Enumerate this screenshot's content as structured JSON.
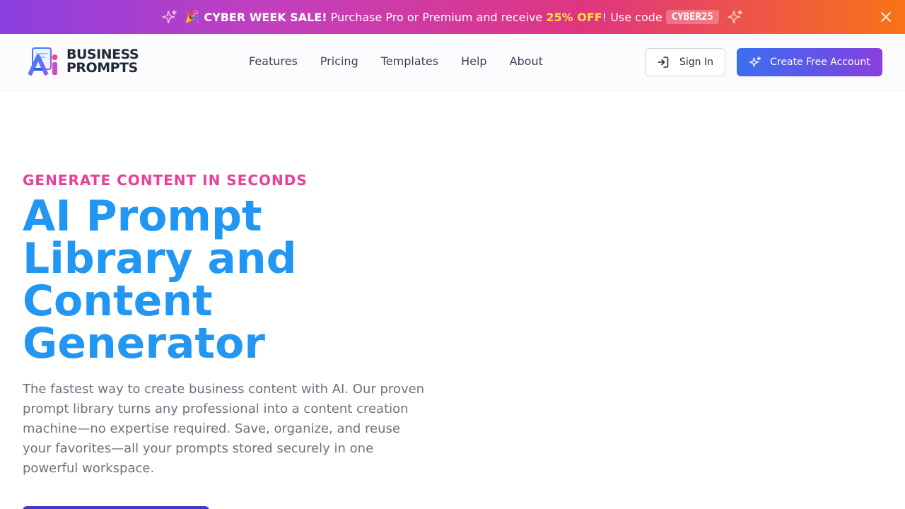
{
  "promo": {
    "emoji": "🎉",
    "headline": "CYBER WEEK SALE!",
    "text_before": "Purchase Pro or Premium and receive",
    "highlight": "25% OFF",
    "text_after": "! Use code",
    "code": "CYBER25"
  },
  "logo": {
    "line1": "BUSINESS",
    "line2": "PROMPTS"
  },
  "nav": {
    "items": [
      "Features",
      "Pricing",
      "Templates",
      "Help",
      "About"
    ]
  },
  "auth": {
    "sign_in": "Sign In",
    "create_account": "Create Free Account"
  },
  "hero": {
    "eyebrow": "GENERATE CONTENT IN SECONDS",
    "title_lines": [
      "AI Prompt",
      "Library and",
      "Content",
      "Generator"
    ],
    "lead": "The fastest way to create business content with AI. Our proven prompt library turns any professional into a content creation machine—no expertise required. Save, organize, and reuse your favorites—all your prompts stored securely in one powerful workspace."
  },
  "colors": {
    "accent_blue": "#2196f3",
    "eyebrow_pink": "#e6409c",
    "highlight_yellow": "#fde047"
  }
}
